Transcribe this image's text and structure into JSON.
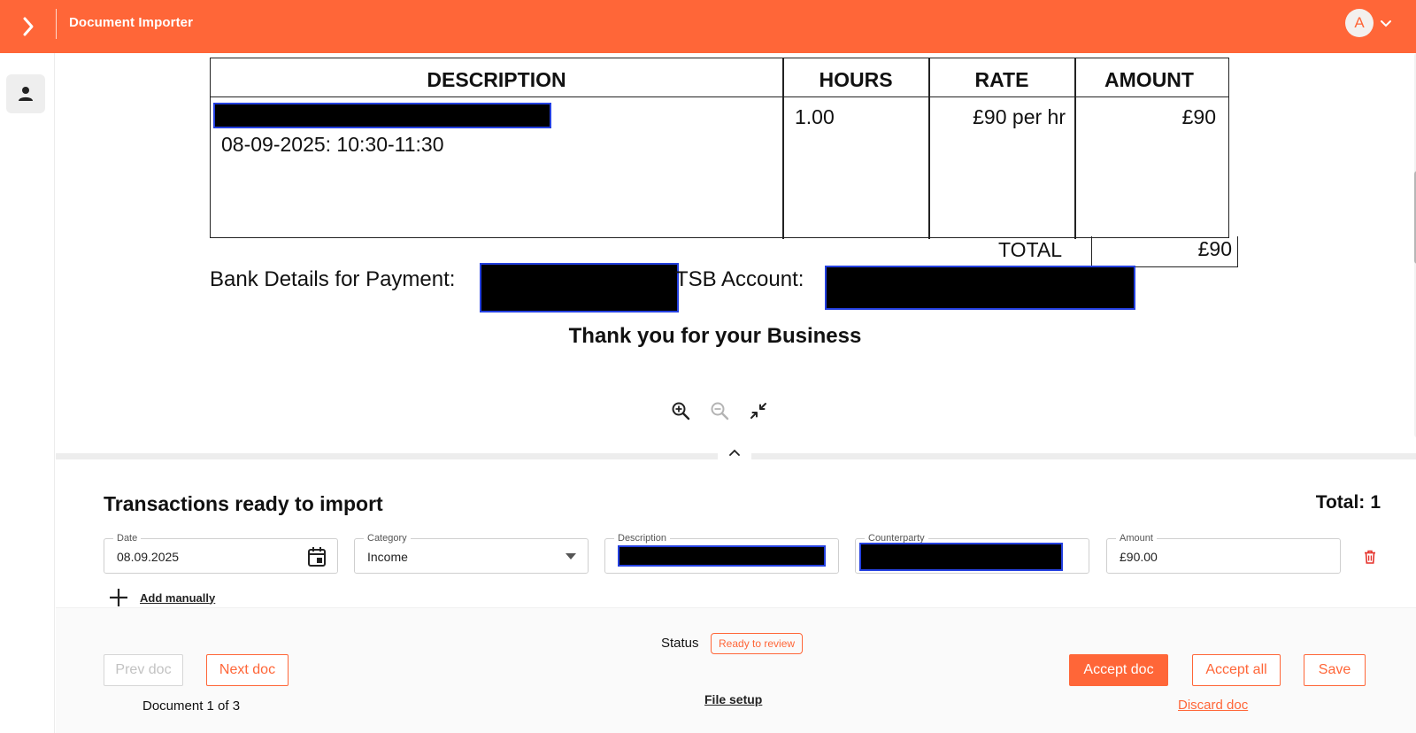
{
  "app": {
    "title": "Document Importer",
    "accent_color": "#ff6638",
    "expand_icon": "chevron-right-icon",
    "user_initial": "A"
  },
  "left_rail": {
    "items": [
      {
        "icon": "person-icon"
      }
    ]
  },
  "document": {
    "table_headers": [
      "DESCRIPTION",
      "HOURS",
      "RATE",
      "AMOUNT"
    ],
    "row": {
      "description_line": "08-09-2025: 10:30-11:30",
      "hours": "1.00",
      "rate": "£90 per hr",
      "amount": "£90"
    },
    "total_label": "TOTAL",
    "total_amount": "£90",
    "bank_label": "Bank Details for Payment:",
    "tsb_label": "TSB Account:",
    "thanks": "Thank you for your Business"
  },
  "viewer_controls": {
    "zoom_in_icon": "zoom-in-icon",
    "zoom_out_icon": "zoom-out-icon",
    "fit_icon": "collapse-icon"
  },
  "transactions": {
    "title": "Transactions ready to import",
    "total_label": "Total:",
    "total_count": "1",
    "fields": {
      "date": {
        "label": "Date",
        "value": "08.09.2025"
      },
      "category": {
        "label": "Category",
        "value": "Income"
      },
      "description": {
        "label": "Description"
      },
      "counterparty": {
        "label": "Counterparty"
      },
      "amount": {
        "label": "Amount",
        "value": "£90.00"
      }
    },
    "add_manually": "Add manually"
  },
  "footer": {
    "prev_doc": "Prev doc",
    "next_doc": "Next doc",
    "status_label": "Status",
    "status_value": "Ready to review",
    "doc_count": "Document 1 of 3",
    "file_setup": "File setup",
    "accept_doc": "Accept doc",
    "accept_all": "Accept all",
    "save": "Save",
    "discard_doc": "Discard doc"
  }
}
